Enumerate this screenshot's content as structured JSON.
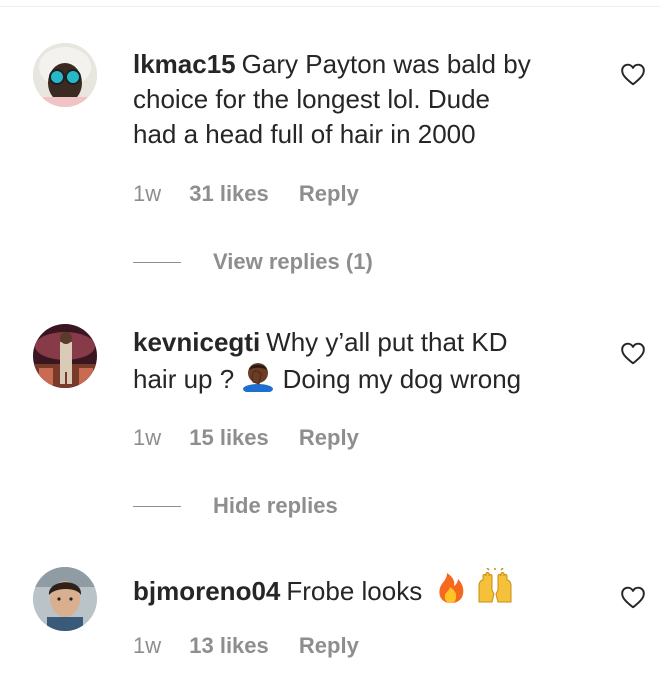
{
  "comments": [
    {
      "username": "lkmac15",
      "text_lines": [
        "Gary Payton was bald by",
        "choice for the longest lol. Dude",
        "had a head full of hair in 2000"
      ],
      "time": "1w",
      "likes": "31 likes",
      "reply": "Reply",
      "replies_toggle": "View replies (1)"
    },
    {
      "username": "kevnicegti",
      "text_a": "Why y’all put that KD",
      "text_b": "hair up ?",
      "text_c": "Doing my dog wrong",
      "emoji": "person-facepalming-emoji",
      "time": "1w",
      "likes": "15 likes",
      "reply": "Reply",
      "replies_toggle": "Hide replies"
    },
    {
      "username": "bjmoreno04",
      "text": "Frobe looks",
      "emojis": [
        "fire-emoji",
        "raising-hands-emoji"
      ],
      "time": "1w",
      "likes": "13 likes",
      "reply": "Reply"
    }
  ],
  "icons": {
    "like": "heart-outline-icon"
  },
  "colors": {
    "text": "#262626",
    "muted": "#8e8e8e",
    "divider": "#efefef"
  }
}
